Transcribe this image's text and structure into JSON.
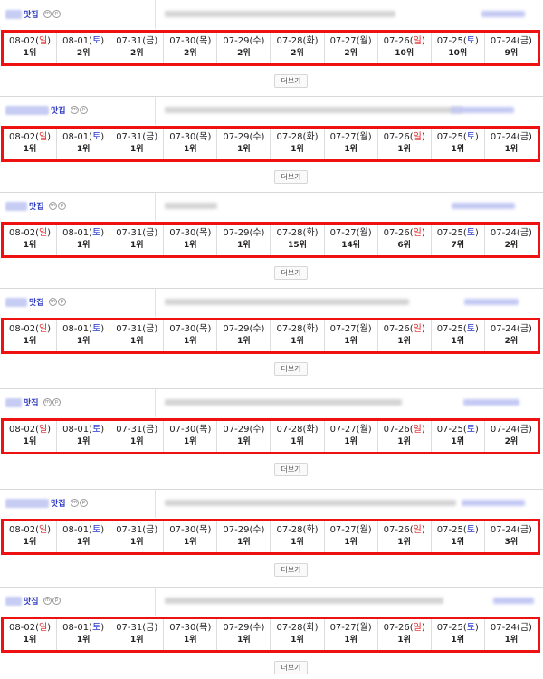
{
  "keyword_label": "맛집",
  "more_label": "더보기",
  "badges": [
    "m",
    "p"
  ],
  "dates": [
    {
      "md": "08-02",
      "dow": "일",
      "type": "sun"
    },
    {
      "md": "08-01",
      "dow": "토",
      "type": "sat"
    },
    {
      "md": "07-31",
      "dow": "금",
      "type": "wd"
    },
    {
      "md": "07-30",
      "dow": "목",
      "type": "wd"
    },
    {
      "md": "07-29",
      "dow": "수",
      "type": "wd"
    },
    {
      "md": "07-28",
      "dow": "화",
      "type": "wd"
    },
    {
      "md": "07-27",
      "dow": "월",
      "type": "wd"
    },
    {
      "md": "07-26",
      "dow": "일",
      "type": "sun"
    },
    {
      "md": "07-25",
      "dow": "토",
      "type": "sat"
    },
    {
      "md": "07-24",
      "dow": "금",
      "type": "wd"
    }
  ],
  "colors": {
    "highlight_border": "#ee1111",
    "sunday": "#e02020",
    "saturday": "#2233cc",
    "keyword": "#2d3ac2"
  },
  "sections": [
    {
      "ranks": [
        "1위",
        "2위",
        "2위",
        "2위",
        "2위",
        "2위",
        "2위",
        "10위",
        "10위",
        "9위"
      ]
    },
    {
      "ranks": [
        "1위",
        "1위",
        "1위",
        "1위",
        "1위",
        "1위",
        "1위",
        "1위",
        "1위",
        "1위"
      ]
    },
    {
      "ranks": [
        "1위",
        "1위",
        "1위",
        "1위",
        "1위",
        "15위",
        "14위",
        "6위",
        "7위",
        "2위"
      ]
    },
    {
      "ranks": [
        "1위",
        "1위",
        "1위",
        "1위",
        "1위",
        "1위",
        "1위",
        "1위",
        "1위",
        "2위"
      ]
    },
    {
      "ranks": [
        "1위",
        "1위",
        "1위",
        "1위",
        "1위",
        "1위",
        "1위",
        "1위",
        "1위",
        "2위"
      ]
    },
    {
      "ranks": [
        "1위",
        "1위",
        "1위",
        "1위",
        "1위",
        "1위",
        "1위",
        "1위",
        "1위",
        "3위"
      ]
    },
    {
      "ranks": [
        "1위",
        "1위",
        "1위",
        "1위",
        "1위",
        "1위",
        "1위",
        "1위",
        "1위",
        "1위"
      ]
    }
  ]
}
